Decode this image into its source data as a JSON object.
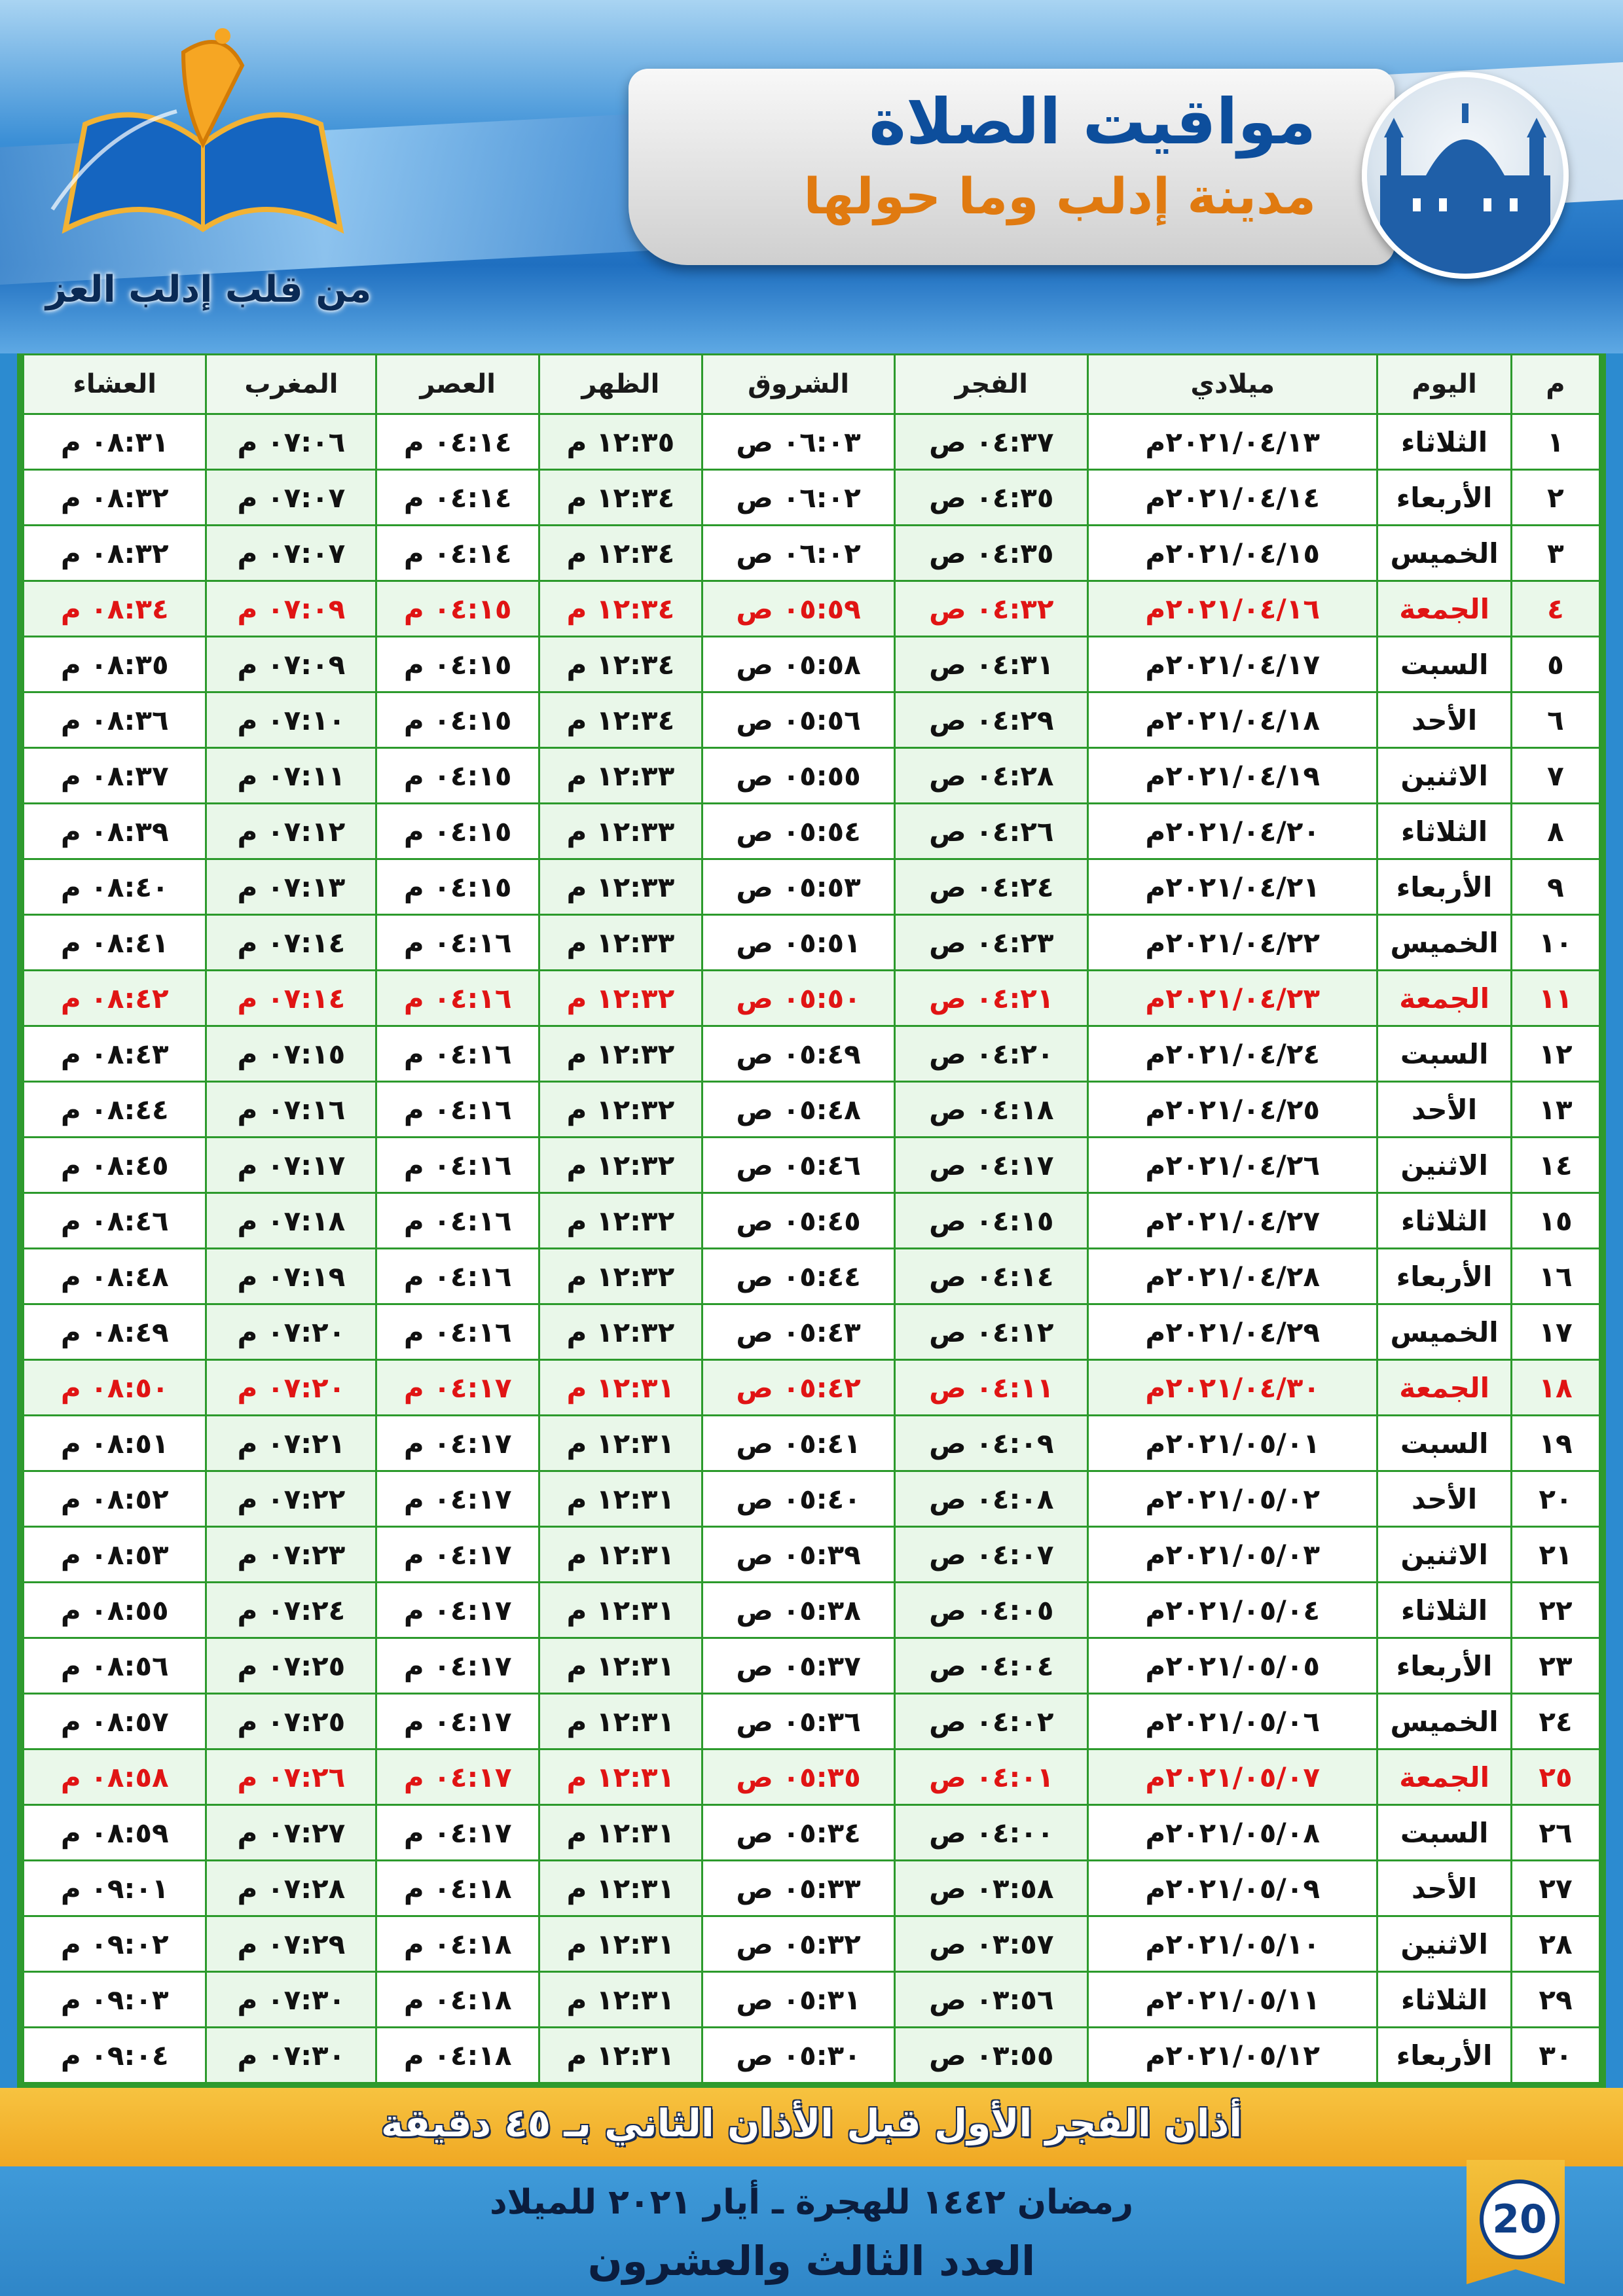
{
  "header": {
    "title": "مواقيت الصلاة",
    "subtitle": "مدينة إدلب وما حولها",
    "logo_text": "من قلب إدلب العز"
  },
  "table": {
    "columns": [
      "م",
      "اليوم",
      "ميلادي",
      "الفجر",
      "الشروق",
      "الظهر",
      "العصر",
      "المغرب",
      "العشاء"
    ],
    "rows": [
      {
        "n": "١",
        "day": "الثلاثاء",
        "date": "٢٠٢١/٠٤/١٣م",
        "fajr": "٠٤:٣٧ ص",
        "sunrise": "٠٦:٠٣ ص",
        "dhuhr": "١٢:٣٥ م",
        "asr": "٠٤:١٤ م",
        "maghrib": "٠٧:٠٦ م",
        "isha": "٠٨:٣١ م",
        "friday": false
      },
      {
        "n": "٢",
        "day": "الأربعاء",
        "date": "٢٠٢١/٠٤/١٤م",
        "fajr": "٠٤:٣٥ ص",
        "sunrise": "٠٦:٠٢ ص",
        "dhuhr": "١٢:٣٤ م",
        "asr": "٠٤:١٤ م",
        "maghrib": "٠٧:٠٧ م",
        "isha": "٠٨:٣٢ م",
        "friday": false
      },
      {
        "n": "٣",
        "day": "الخميس",
        "date": "٢٠٢١/٠٤/١٥م",
        "fajr": "٠٤:٣٥ ص",
        "sunrise": "٠٦:٠٢ ص",
        "dhuhr": "١٢:٣٤ م",
        "asr": "٠٤:١٤ م",
        "maghrib": "٠٧:٠٧ م",
        "isha": "٠٨:٣٢ م",
        "friday": false
      },
      {
        "n": "٤",
        "day": "الجمعة",
        "date": "٢٠٢١/٠٤/١٦م",
        "fajr": "٠٤:٣٢ ص",
        "sunrise": "٠٥:٥٩ ص",
        "dhuhr": "١٢:٣٤ م",
        "asr": "٠٤:١٥ م",
        "maghrib": "٠٧:٠٩ م",
        "isha": "٠٨:٣٤ م",
        "friday": true
      },
      {
        "n": "٥",
        "day": "السبت",
        "date": "٢٠٢١/٠٤/١٧م",
        "fajr": "٠٤:٣١ ص",
        "sunrise": "٠٥:٥٨ ص",
        "dhuhr": "١٢:٣٤ م",
        "asr": "٠٤:١٥ م",
        "maghrib": "٠٧:٠٩ م",
        "isha": "٠٨:٣٥ م",
        "friday": false
      },
      {
        "n": "٦",
        "day": "الأحد",
        "date": "٢٠٢١/٠٤/١٨م",
        "fajr": "٠٤:٢٩ ص",
        "sunrise": "٠٥:٥٦ ص",
        "dhuhr": "١٢:٣٤ م",
        "asr": "٠٤:١٥ م",
        "maghrib": "٠٧:١٠ م",
        "isha": "٠٨:٣٦ م",
        "friday": false
      },
      {
        "n": "٧",
        "day": "الاثنين",
        "date": "٢٠٢١/٠٤/١٩م",
        "fajr": "٠٤:٢٨ ص",
        "sunrise": "٠٥:٥٥ ص",
        "dhuhr": "١٢:٣٣ م",
        "asr": "٠٤:١٥ م",
        "maghrib": "٠٧:١١ م",
        "isha": "٠٨:٣٧ م",
        "friday": false
      },
      {
        "n": "٨",
        "day": "الثلاثاء",
        "date": "٢٠٢١/٠٤/٢٠م",
        "fajr": "٠٤:٢٦ ص",
        "sunrise": "٠٥:٥٤ ص",
        "dhuhr": "١٢:٣٣ م",
        "asr": "٠٤:١٥ م",
        "maghrib": "٠٧:١٢ م",
        "isha": "٠٨:٣٩ م",
        "friday": false
      },
      {
        "n": "٩",
        "day": "الأربعاء",
        "date": "٢٠٢١/٠٤/٢١م",
        "fajr": "٠٤:٢٤ ص",
        "sunrise": "٠٥:٥٣ ص",
        "dhuhr": "١٢:٣٣ م",
        "asr": "٠٤:١٥ م",
        "maghrib": "٠٧:١٣ م",
        "isha": "٠٨:٤٠ م",
        "friday": false
      },
      {
        "n": "١٠",
        "day": "الخميس",
        "date": "٢٠٢١/٠٤/٢٢م",
        "fajr": "٠٤:٢٣ ص",
        "sunrise": "٠٥:٥١ ص",
        "dhuhr": "١٢:٣٣ م",
        "asr": "٠٤:١٦ م",
        "maghrib": "٠٧:١٤ م",
        "isha": "٠٨:٤١ م",
        "friday": false
      },
      {
        "n": "١١",
        "day": "الجمعة",
        "date": "٢٠٢١/٠٤/٢٣م",
        "fajr": "٠٤:٢١ ص",
        "sunrise": "٠٥:٥٠ ص",
        "dhuhr": "١٢:٣٢ م",
        "asr": "٠٤:١٦ م",
        "maghrib": "٠٧:١٤ م",
        "isha": "٠٨:٤٢ م",
        "friday": true
      },
      {
        "n": "١٢",
        "day": "السبت",
        "date": "٢٠٢١/٠٤/٢٤م",
        "fajr": "٠٤:٢٠ ص",
        "sunrise": "٠٥:٤٩ ص",
        "dhuhr": "١٢:٣٢ م",
        "asr": "٠٤:١٦ م",
        "maghrib": "٠٧:١٥ م",
        "isha": "٠٨:٤٣ م",
        "friday": false
      },
      {
        "n": "١٣",
        "day": "الأحد",
        "date": "٢٠٢١/٠٤/٢٥م",
        "fajr": "٠٤:١٨ ص",
        "sunrise": "٠٥:٤٨ ص",
        "dhuhr": "١٢:٣٢ م",
        "asr": "٠٤:١٦ م",
        "maghrib": "٠٧:١٦ م",
        "isha": "٠٨:٤٤ م",
        "friday": false
      },
      {
        "n": "١٤",
        "day": "الاثنين",
        "date": "٢٠٢١/٠٤/٢٦م",
        "fajr": "٠٤:١٧ ص",
        "sunrise": "٠٥:٤٦ ص",
        "dhuhr": "١٢:٣٢ م",
        "asr": "٠٤:١٦ م",
        "maghrib": "٠٧:١٧ م",
        "isha": "٠٨:٤٥ م",
        "friday": false
      },
      {
        "n": "١٥",
        "day": "الثلاثاء",
        "date": "٢٠٢١/٠٤/٢٧م",
        "fajr": "٠٤:١٥ ص",
        "sunrise": "٠٥:٤٥ ص",
        "dhuhr": "١٢:٣٢ م",
        "asr": "٠٤:١٦ م",
        "maghrib": "٠٧:١٨ م",
        "isha": "٠٨:٤٦ م",
        "friday": false
      },
      {
        "n": "١٦",
        "day": "الأربعاء",
        "date": "٢٠٢١/٠٤/٢٨م",
        "fajr": "٠٤:١٤ ص",
        "sunrise": "٠٥:٤٤ ص",
        "dhuhr": "١٢:٣٢ م",
        "asr": "٠٤:١٦ م",
        "maghrib": "٠٧:١٩ م",
        "isha": "٠٨:٤٨ م",
        "friday": false
      },
      {
        "n": "١٧",
        "day": "الخميس",
        "date": "٢٠٢١/٠٤/٢٩م",
        "fajr": "٠٤:١٢ ص",
        "sunrise": "٠٥:٤٣ ص",
        "dhuhr": "١٢:٣٢ م",
        "asr": "٠٤:١٦ م",
        "maghrib": "٠٧:٢٠ م",
        "isha": "٠٨:٤٩ م",
        "friday": false
      },
      {
        "n": "١٨",
        "day": "الجمعة",
        "date": "٢٠٢١/٠٤/٣٠م",
        "fajr": "٠٤:١١ ص",
        "sunrise": "٠٥:٤٢ ص",
        "dhuhr": "١٢:٣١ م",
        "asr": "٠٤:١٧ م",
        "maghrib": "٠٧:٢٠ م",
        "isha": "٠٨:٥٠ م",
        "friday": true
      },
      {
        "n": "١٩",
        "day": "السبت",
        "date": "٢٠٢١/٠٥/٠١م",
        "fajr": "٠٤:٠٩ ص",
        "sunrise": "٠٥:٤١ ص",
        "dhuhr": "١٢:٣١ م",
        "asr": "٠٤:١٧ م",
        "maghrib": "٠٧:٢١ م",
        "isha": "٠٨:٥١ م",
        "friday": false
      },
      {
        "n": "٢٠",
        "day": "الأحد",
        "date": "٢٠٢١/٠٥/٠٢م",
        "fajr": "٠٤:٠٨ ص",
        "sunrise": "٠٥:٤٠ ص",
        "dhuhr": "١٢:٣١ م",
        "asr": "٠٤:١٧ م",
        "maghrib": "٠٧:٢٢ م",
        "isha": "٠٨:٥٢ م",
        "friday": false
      },
      {
        "n": "٢١",
        "day": "الاثنين",
        "date": "٢٠٢١/٠٥/٠٣م",
        "fajr": "٠٤:٠٧ ص",
        "sunrise": "٠٥:٣٩ ص",
        "dhuhr": "١٢:٣١ م",
        "asr": "٠٤:١٧ م",
        "maghrib": "٠٧:٢٣ م",
        "isha": "٠٨:٥٣ م",
        "friday": false
      },
      {
        "n": "٢٢",
        "day": "الثلاثاء",
        "date": "٢٠٢١/٠٥/٠٤م",
        "fajr": "٠٤:٠٥ ص",
        "sunrise": "٠٥:٣٨ ص",
        "dhuhr": "١٢:٣١ م",
        "asr": "٠٤:١٧ م",
        "maghrib": "٠٧:٢٤ م",
        "isha": "٠٨:٥٥ م",
        "friday": false
      },
      {
        "n": "٢٣",
        "day": "الأربعاء",
        "date": "٢٠٢١/٠٥/٠٥م",
        "fajr": "٠٤:٠٤ ص",
        "sunrise": "٠٥:٣٧ ص",
        "dhuhr": "١٢:٣١ م",
        "asr": "٠٤:١٧ م",
        "maghrib": "٠٧:٢٥ م",
        "isha": "٠٨:٥٦ م",
        "friday": false
      },
      {
        "n": "٢٤",
        "day": "الخميس",
        "date": "٢٠٢١/٠٥/٠٦م",
        "fajr": "٠٤:٠٢ ص",
        "sunrise": "٠٥:٣٦ ص",
        "dhuhr": "١٢:٣١ م",
        "asr": "٠٤:١٧ م",
        "maghrib": "٠٧:٢٥ م",
        "isha": "٠٨:٥٧ م",
        "friday": false
      },
      {
        "n": "٢٥",
        "day": "الجمعة",
        "date": "٢٠٢١/٠٥/٠٧م",
        "fajr": "٠٤:٠١ ص",
        "sunrise": "٠٥:٣٥ ص",
        "dhuhr": "١٢:٣١ م",
        "asr": "٠٤:١٧ م",
        "maghrib": "٠٧:٢٦ م",
        "isha": "٠٨:٥٨ م",
        "friday": true
      },
      {
        "n": "٢٦",
        "day": "السبت",
        "date": "٢٠٢١/٠٥/٠٨م",
        "fajr": "٠٤:٠٠ ص",
        "sunrise": "٠٥:٣٤ ص",
        "dhuhr": "١٢:٣١ م",
        "asr": "٠٤:١٧ م",
        "maghrib": "٠٧:٢٧ م",
        "isha": "٠٨:٥٩ م",
        "friday": false
      },
      {
        "n": "٢٧",
        "day": "الأحد",
        "date": "٢٠٢١/٠٥/٠٩م",
        "fajr": "٠٣:٥٨ ص",
        "sunrise": "٠٥:٣٣ ص",
        "dhuhr": "١٢:٣١ م",
        "asr": "٠٤:١٨ م",
        "maghrib": "٠٧:٢٨ م",
        "isha": "٠٩:٠١ م",
        "friday": false
      },
      {
        "n": "٢٨",
        "day": "الاثنين",
        "date": "٢٠٢١/٠٥/١٠م",
        "fajr": "٠٣:٥٧ ص",
        "sunrise": "٠٥:٣٢ ص",
        "dhuhr": "١٢:٣١ م",
        "asr": "٠٤:١٨ م",
        "maghrib": "٠٧:٢٩ م",
        "isha": "٠٩:٠٢ م",
        "friday": false
      },
      {
        "n": "٢٩",
        "day": "الثلاثاء",
        "date": "٢٠٢١/٠٥/١١م",
        "fajr": "٠٣:٥٦ ص",
        "sunrise": "٠٥:٣١ ص",
        "dhuhr": "١٢:٣١ م",
        "asr": "٠٤:١٨ م",
        "maghrib": "٠٧:٣٠ م",
        "isha": "٠٩:٠٣ م",
        "friday": false
      },
      {
        "n": "٣٠",
        "day": "الأربعاء",
        "date": "٢٠٢١/٠٥/١٢م",
        "fajr": "٠٣:٥٥ ص",
        "sunrise": "٠٥:٣٠ ص",
        "dhuhr": "١٢:٣١ م",
        "asr": "٠٤:١٨ م",
        "maghrib": "٠٧:٣٠ م",
        "isha": "٠٩:٠٤ م",
        "friday": false
      }
    ]
  },
  "notice": "أذان الفجر الأول قبل الأذان الثاني بـ ٤٥ دقيقة",
  "footer": {
    "date_line": "رمضان ١٤٤٢ للهجرة ـ أيار ٢٠٢١ للميلاد",
    "issue_line": "العدد الثالث والعشرون",
    "badge": "20"
  },
  "colors": {
    "friday_text": "#e01414",
    "grid": "#2c9a2c",
    "highlight_col": "#e9f7e9"
  }
}
